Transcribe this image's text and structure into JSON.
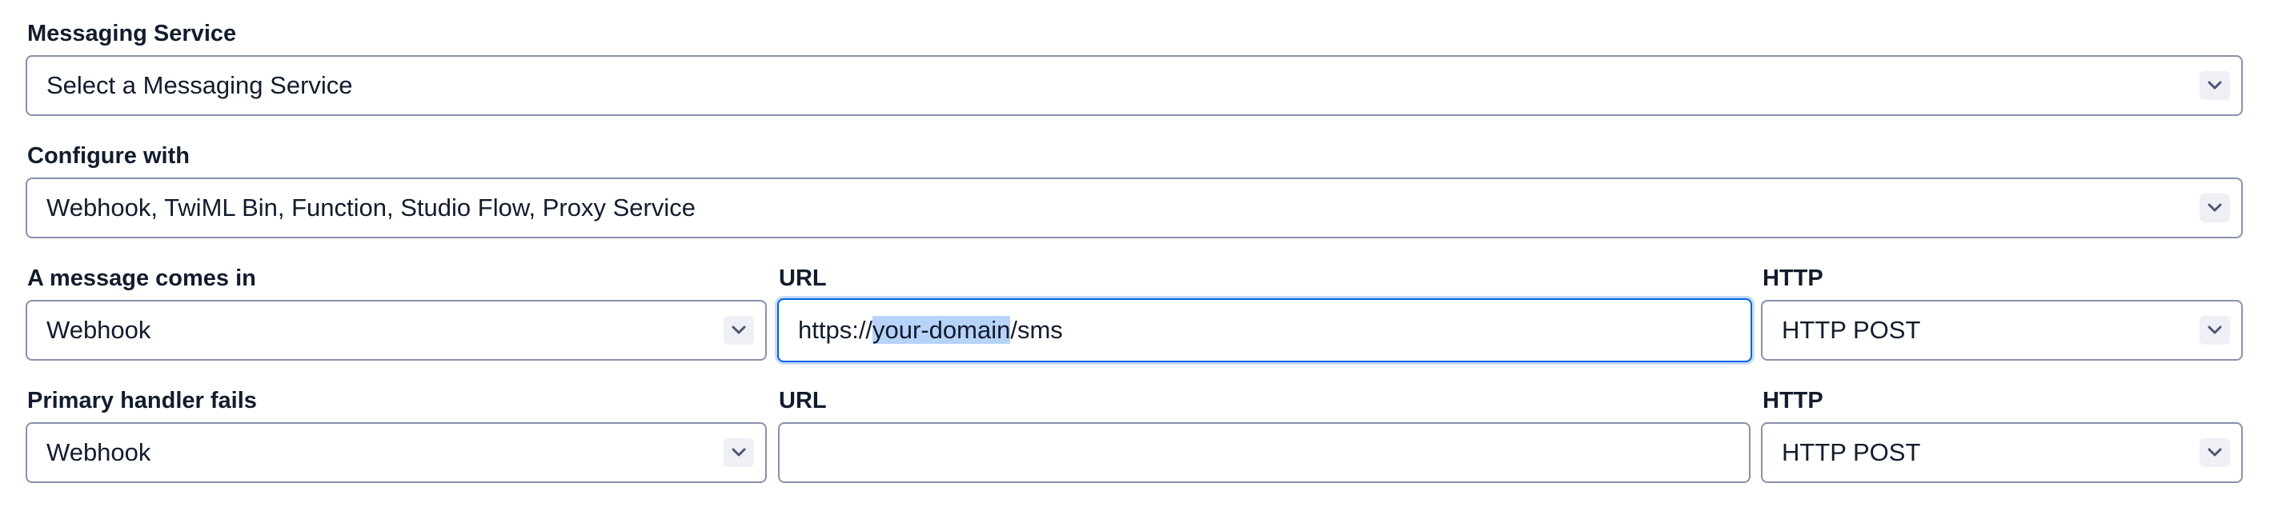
{
  "messaging_service": {
    "label": "Messaging Service",
    "value": "Select a Messaging Service"
  },
  "configure_with": {
    "label": "Configure with",
    "value": "Webhook, TwiML Bin, Function, Studio Flow, Proxy Service"
  },
  "message_comes_in": {
    "label": "A message comes in",
    "handler_value": "Webhook",
    "url_label": "URL",
    "url_prefix": "https://",
    "url_selected": "your-domain",
    "url_suffix": "/sms",
    "http_label": "HTTP",
    "http_value": "HTTP POST"
  },
  "primary_handler_fails": {
    "label": "Primary handler fails",
    "handler_value": "Webhook",
    "url_label": "URL",
    "url_value": "",
    "http_label": "HTTP",
    "http_value": "HTTP POST"
  },
  "icons": {
    "dropdown": "chevron-down-icon"
  },
  "colors": {
    "text": "#121c2d",
    "border": "#8891aa",
    "focus_border": "#0263e0",
    "selection": "#b7d3f9",
    "chevron_bg": "#eef0f6"
  }
}
